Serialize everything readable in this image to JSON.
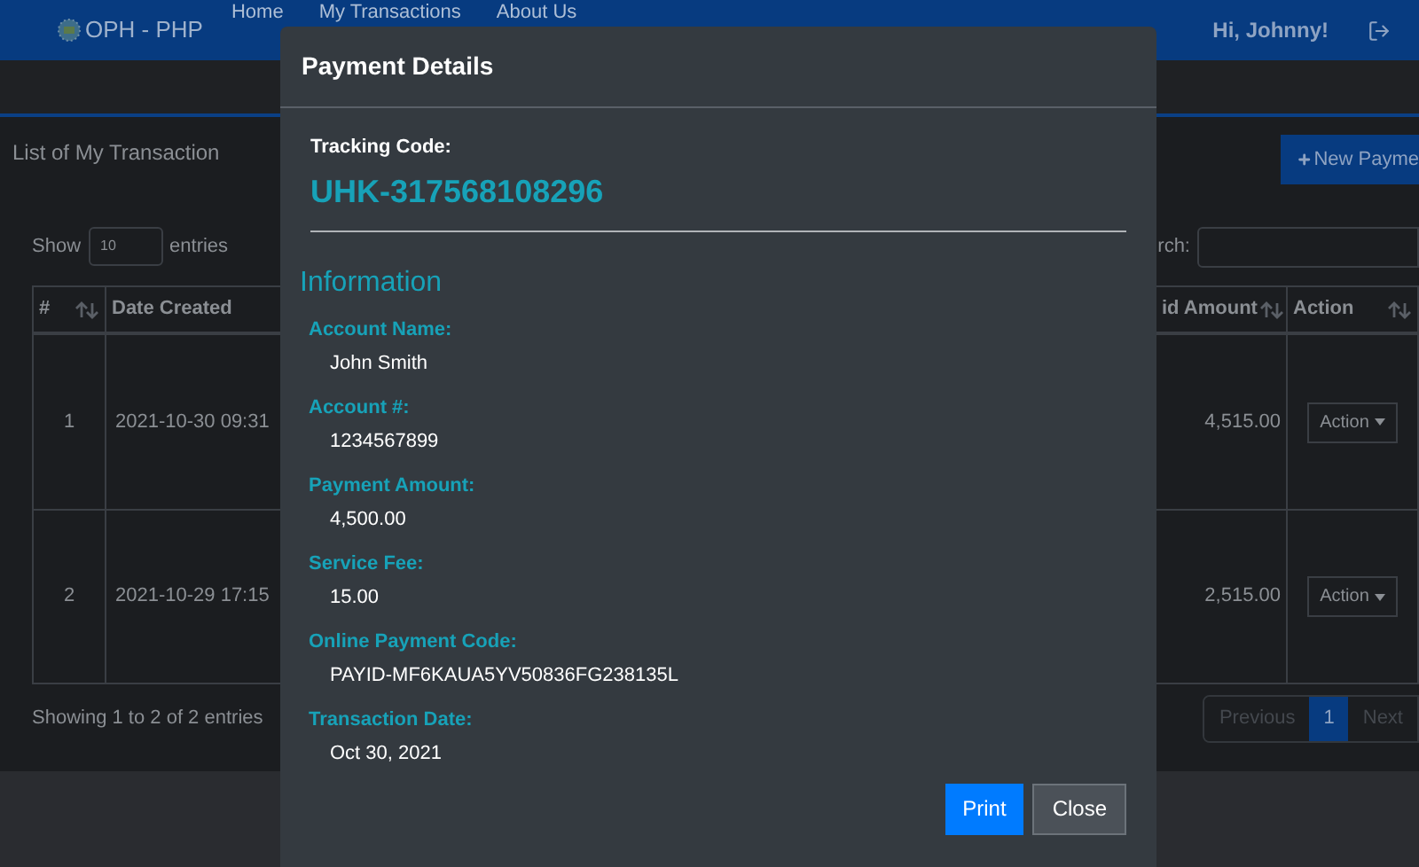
{
  "navbar": {
    "brand": "OPH - PHP",
    "links": [
      "Home",
      "My Transactions",
      "About Us"
    ],
    "greeting": "Hi, Johnny!"
  },
  "page": {
    "title": "List of My Transaction",
    "new_button": "New Payme",
    "show_label": "Show",
    "page_size": "10",
    "entries_label": "entries",
    "search_label": "rch:",
    "table": {
      "columns": [
        "#",
        "Date Created",
        "id Amount",
        "Action"
      ],
      "rows": [
        {
          "number": "1",
          "date_created": "2021-10-30 09:31",
          "paid_amount": "4,515.00",
          "action": "Action"
        },
        {
          "number": "2",
          "date_created": "2021-10-29 17:15",
          "paid_amount": "2,515.00",
          "action": "Action"
        }
      ]
    },
    "info": "Showing 1 to 2 of 2 entries",
    "pagination": [
      {
        "label": "Previous",
        "selected": false,
        "disabled": true
      },
      {
        "label": "1",
        "selected": true,
        "disabled": false
      },
      {
        "label": "Next",
        "selected": false,
        "disabled": true
      }
    ]
  },
  "modal": {
    "title": "Payment Details",
    "tracking_label": "Tracking Code:",
    "tracking_code": "UHK-317568108296",
    "section": "Information",
    "fields": [
      {
        "label": "Account Name:",
        "value": "John Smith"
      },
      {
        "label": "Account #:",
        "value": "1234567899"
      },
      {
        "label": "Payment Amount:",
        "value": "4,500.00"
      },
      {
        "label": "Service Fee:",
        "value": "15.00"
      },
      {
        "label": "Online Payment Code:",
        "value": "PAYID-MF6KAUA5YV50836FG238135L"
      },
      {
        "label": "Transaction Date:",
        "value": "Oct 30, 2021"
      }
    ],
    "buttons": [
      {
        "label": "Print",
        "kind": "primary"
      },
      {
        "label": "Close",
        "kind": "secondary"
      }
    ]
  }
}
